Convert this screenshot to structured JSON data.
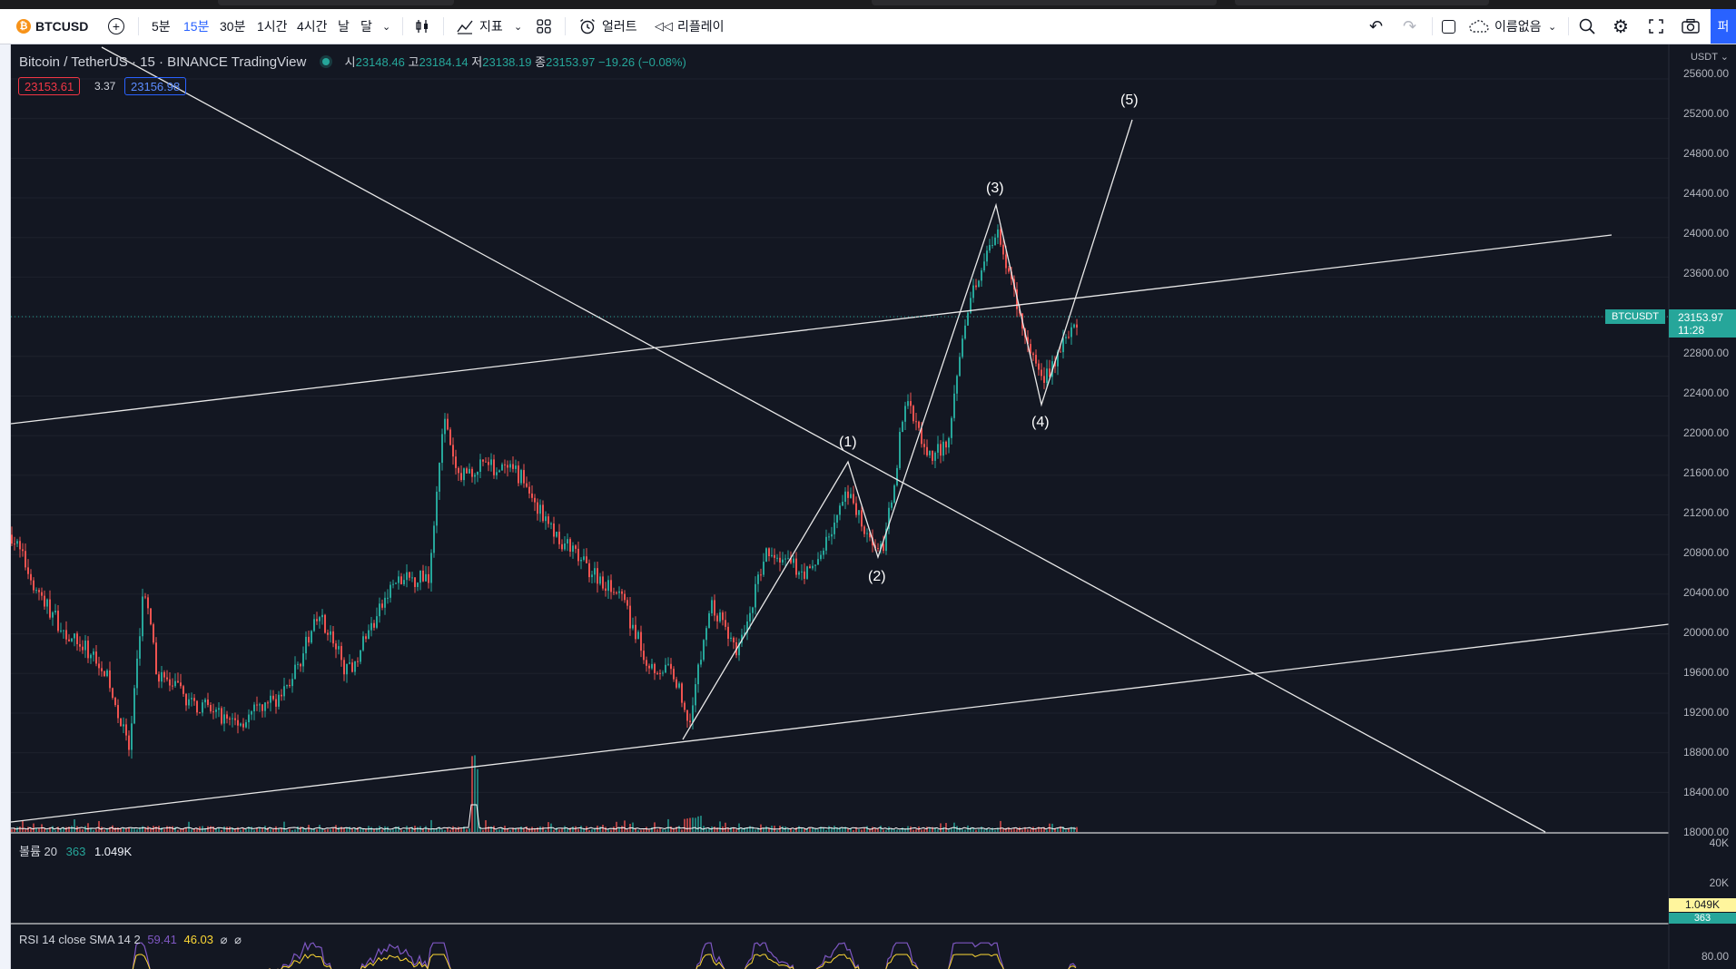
{
  "toolbar": {
    "symbol": "BTCUSD",
    "intervals": [
      "5분",
      "15분",
      "30분",
      "1시간",
      "4시간",
      "날",
      "달"
    ],
    "active_interval": "15분",
    "indicators_label": "지표",
    "alert_label": "얼러트",
    "replay_label": "리플레이",
    "layout_name": "이름없음",
    "publish_label": "퍼"
  },
  "legend": {
    "title": "Bitcoin / TetherUS",
    "interval": "15",
    "exchange": "BINANCE",
    "source": "TradingView",
    "open_label": "시",
    "open": "23148.46",
    "high_label": "고",
    "high": "23184.14",
    "low_label": "저",
    "low": "23138.19",
    "close_label": "종",
    "close": "23153.97",
    "change": "−19.26 (−0.08%)",
    "sell_price": "23153.61",
    "spread": "3.37",
    "buy_price": "23156.98"
  },
  "waves": [
    {
      "label": "(1)"
    },
    {
      "label": "(2)"
    },
    {
      "label": "(3)"
    },
    {
      "label": "(4)"
    },
    {
      "label": "(5)"
    }
  ],
  "price_axis": {
    "currency": "USDT",
    "ticks": [
      "25600.00",
      "25200.00",
      "24800.00",
      "24400.00",
      "24000.00",
      "23600.00",
      "22800.00",
      "22400.00",
      "22000.00",
      "21600.00",
      "21200.00",
      "20800.00",
      "20400.00",
      "20000.00",
      "19600.00",
      "19200.00",
      "18800.00",
      "18400.00",
      "18000.00"
    ],
    "current_symbol": "BTCUSDT",
    "current_price": "23153.97",
    "countdown": "11:28"
  },
  "volume_pane": {
    "name": "볼륨",
    "length": "20",
    "value1": "363",
    "value2": "1.049K",
    "ticks": [
      "40K",
      "20K"
    ],
    "last_tag": "1.049K",
    "second_tag": "363"
  },
  "rsi_pane": {
    "label": "RSI 14 close SMA 14 2",
    "value1": "59.41",
    "value2": "46.03",
    "tick": "80.00"
  },
  "colors": {
    "up": "#26a69a",
    "down": "#ef5350",
    "accent": "#2962ff",
    "rsi": "#7e57c2",
    "rsi_ma": "#fdd835"
  },
  "chart_data": {
    "type": "candlestick",
    "ylim": [
      18000,
      25800
    ],
    "drawn_lines": "trendlines and Elliott wave (1)-(5) zigzag",
    "wave_points": [
      {
        "label": "(1)",
        "price": 21680
      },
      {
        "label": "(2)",
        "price": 20750
      },
      {
        "label": "(3)",
        "price": 24280
      },
      {
        "label": "(4)",
        "price": 22310
      },
      {
        "label": "(5)",
        "price": 25130
      }
    ]
  }
}
